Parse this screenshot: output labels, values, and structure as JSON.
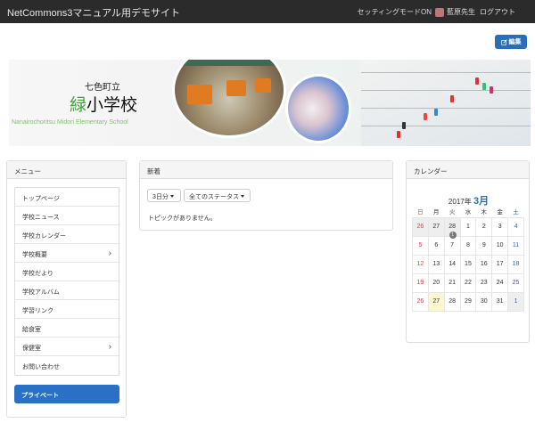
{
  "topbar": {
    "site_title": "NetCommons3マニュアル用デモサイト",
    "setting_mode": "セッティングモードON",
    "user_name": "藍原先生",
    "logout": "ログアウト"
  },
  "edit_button": {
    "label": "編集",
    "icon": "edit-icon"
  },
  "banner": {
    "town": "七色町立",
    "school_green": "緑",
    "school_rest": "小学校",
    "roman": "Nanairochoritsu Midori Elementary School"
  },
  "menu": {
    "title": "メニュー",
    "items": [
      {
        "label": "トップページ",
        "has_children": false
      },
      {
        "label": "学校ニュース",
        "has_children": false
      },
      {
        "label": "学校カレンダー",
        "has_children": false
      },
      {
        "label": "学校概要",
        "has_children": true
      },
      {
        "label": "学校だより",
        "has_children": false
      },
      {
        "label": "学校アルバム",
        "has_children": false
      },
      {
        "label": "学習リンク",
        "has_children": false
      },
      {
        "label": "給食室",
        "has_children": false
      },
      {
        "label": "保健室",
        "has_children": true
      },
      {
        "label": "お問い合わせ",
        "has_children": false
      }
    ],
    "private_button": "プライベート"
  },
  "news": {
    "title": "新着",
    "period": "3日分",
    "status": "全てのステータス",
    "empty": "トピックがありません。"
  },
  "calendar": {
    "title": "カレンダー",
    "year_label": "2017年",
    "month_label": "3月",
    "weekdays": [
      "日",
      "月",
      "火",
      "水",
      "木",
      "金",
      "土"
    ],
    "weeks": [
      [
        {
          "d": "26",
          "o": true
        },
        {
          "d": "27",
          "o": true
        },
        {
          "d": "28",
          "o": true,
          "badge": "1"
        },
        {
          "d": "1"
        },
        {
          "d": "2"
        },
        {
          "d": "3"
        },
        {
          "d": "4"
        }
      ],
      [
        {
          "d": "5"
        },
        {
          "d": "6"
        },
        {
          "d": "7"
        },
        {
          "d": "8"
        },
        {
          "d": "9"
        },
        {
          "d": "10"
        },
        {
          "d": "11"
        }
      ],
      [
        {
          "d": "12"
        },
        {
          "d": "13"
        },
        {
          "d": "14"
        },
        {
          "d": "15"
        },
        {
          "d": "16"
        },
        {
          "d": "17"
        },
        {
          "d": "18"
        }
      ],
      [
        {
          "d": "19"
        },
        {
          "d": "20"
        },
        {
          "d": "21"
        },
        {
          "d": "22"
        },
        {
          "d": "23"
        },
        {
          "d": "24"
        },
        {
          "d": "25"
        }
      ],
      [
        {
          "d": "26"
        },
        {
          "d": "27",
          "today": true
        },
        {
          "d": "28"
        },
        {
          "d": "29"
        },
        {
          "d": "30"
        },
        {
          "d": "31"
        },
        {
          "d": "1",
          "o": true
        }
      ]
    ],
    "sunday_color": "#d04545",
    "saturday_color": "#3a5fb0",
    "month_color": "#2a6fb5"
  },
  "colors": {
    "topbar": "#2b2b2b",
    "primary": "#2a6fb5",
    "private": "#2a70c4",
    "green": "#3fa63a"
  }
}
